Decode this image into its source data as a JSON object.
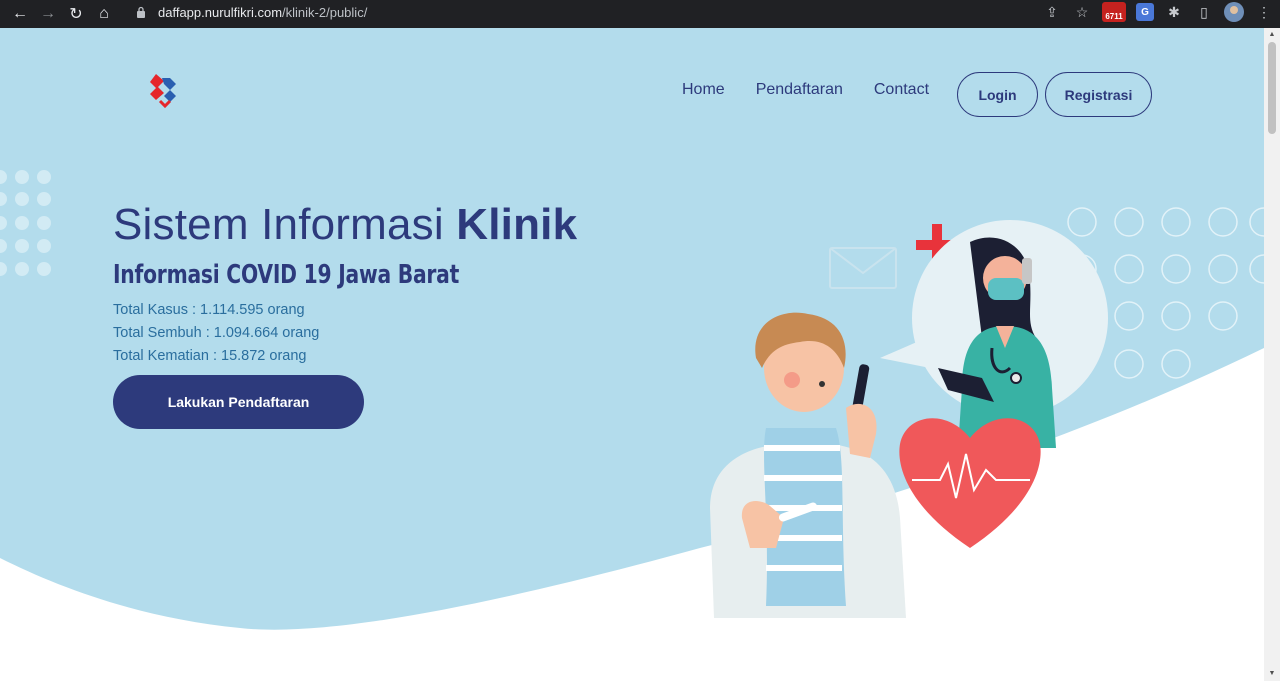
{
  "browser": {
    "url_host": "daffapp.nurulfikri.com",
    "url_path": "/klinik-2/public/",
    "badge_count": "6711"
  },
  "header": {
    "nav": [
      "Home",
      "Pendaftaran",
      "Contact"
    ],
    "login_label": "Login",
    "register_label": "Registrasi"
  },
  "hero": {
    "title_light": "Sistem Informasi ",
    "title_bold": "Klinik",
    "subtitle": "Informasi COVID 19 Jawa Barat",
    "stats": [
      "Total Kasus : 1.114.595 orang",
      "Total Sembuh : 1.094.664 orang",
      "Total Kematian : 15.872 orang"
    ],
    "cta_label": "Lakukan Pendaftaran"
  },
  "colors": {
    "hero_bg": "#b3dcec",
    "primary": "#2d3a7c",
    "stat_text": "#2a6e9e",
    "logo_red": "#e5262b",
    "logo_blue": "#2a5fb0",
    "heart": "#f0585a"
  }
}
